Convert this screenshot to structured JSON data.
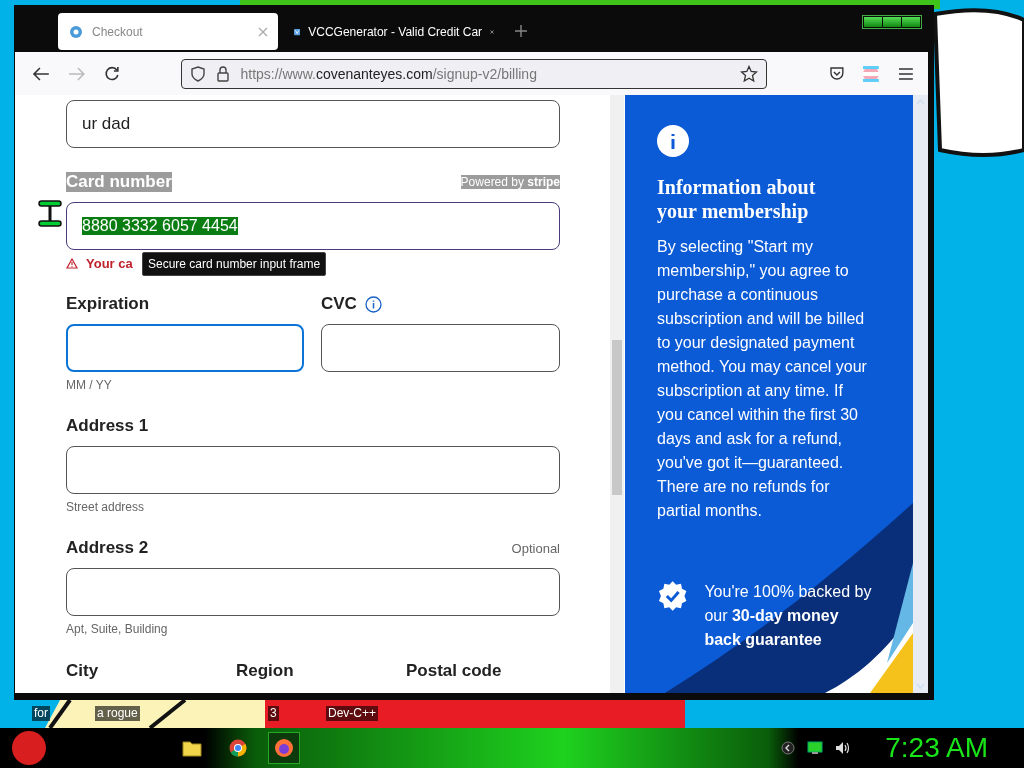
{
  "desktop": {
    "icon_labels": [
      "for",
      "a rogue",
      "3",
      "Dev-C++"
    ]
  },
  "browser": {
    "tabs": [
      {
        "title": "Checkout",
        "selected": true
      },
      {
        "title": "VCCGenerator - Valid Credit Car",
        "selected": false
      }
    ],
    "url": {
      "prefix": "https://www.",
      "domain": "covenanteyes.com",
      "path": "/signup-v2/billing"
    }
  },
  "form": {
    "name_field": {
      "value": "ur dad"
    },
    "card_number": {
      "label": "Card number",
      "label_selected": true,
      "powered_by": "Powered by **stripe**",
      "value": "8880 3332 6057 4454",
      "value_selected": true,
      "error": "Your ca",
      "tooltip": "Secure card number input frame"
    },
    "expiration": {
      "label": "Expiration",
      "focused": true,
      "hint": "MM / YY"
    },
    "cvc": {
      "label": "CVC",
      "focused": false
    },
    "address_1": {
      "label": "Address 1",
      "focused": false,
      "hint": "Street address"
    },
    "address_2": {
      "label": "Address 2",
      "focused": false,
      "optional": "Optional",
      "hint": "Apt, Suite, Building"
    },
    "bottom_labels": [
      "City",
      "Region",
      "Postal code"
    ]
  },
  "info_panel": {
    "title": "Information about your membership",
    "text": "By selecting \"Start my membership,\" you agree to purchase a continuous subscription and will be billed to your designated payment method. You may cancel your subscription at any time. If you cancel within the first 30 days and ask for a refund, you've got it—guaranteed. There are no refunds for partial months.",
    "guarantee": "You're 100% backed by our **30-day money back guarantee**"
  },
  "taskbar": {
    "apps": [
      {
        "kind": "folder",
        "selected": false
      },
      {
        "kind": "chrome",
        "selected": false
      },
      {
        "kind": "firefox",
        "selected": true
      }
    ],
    "clock": "7:23 AM"
  }
}
